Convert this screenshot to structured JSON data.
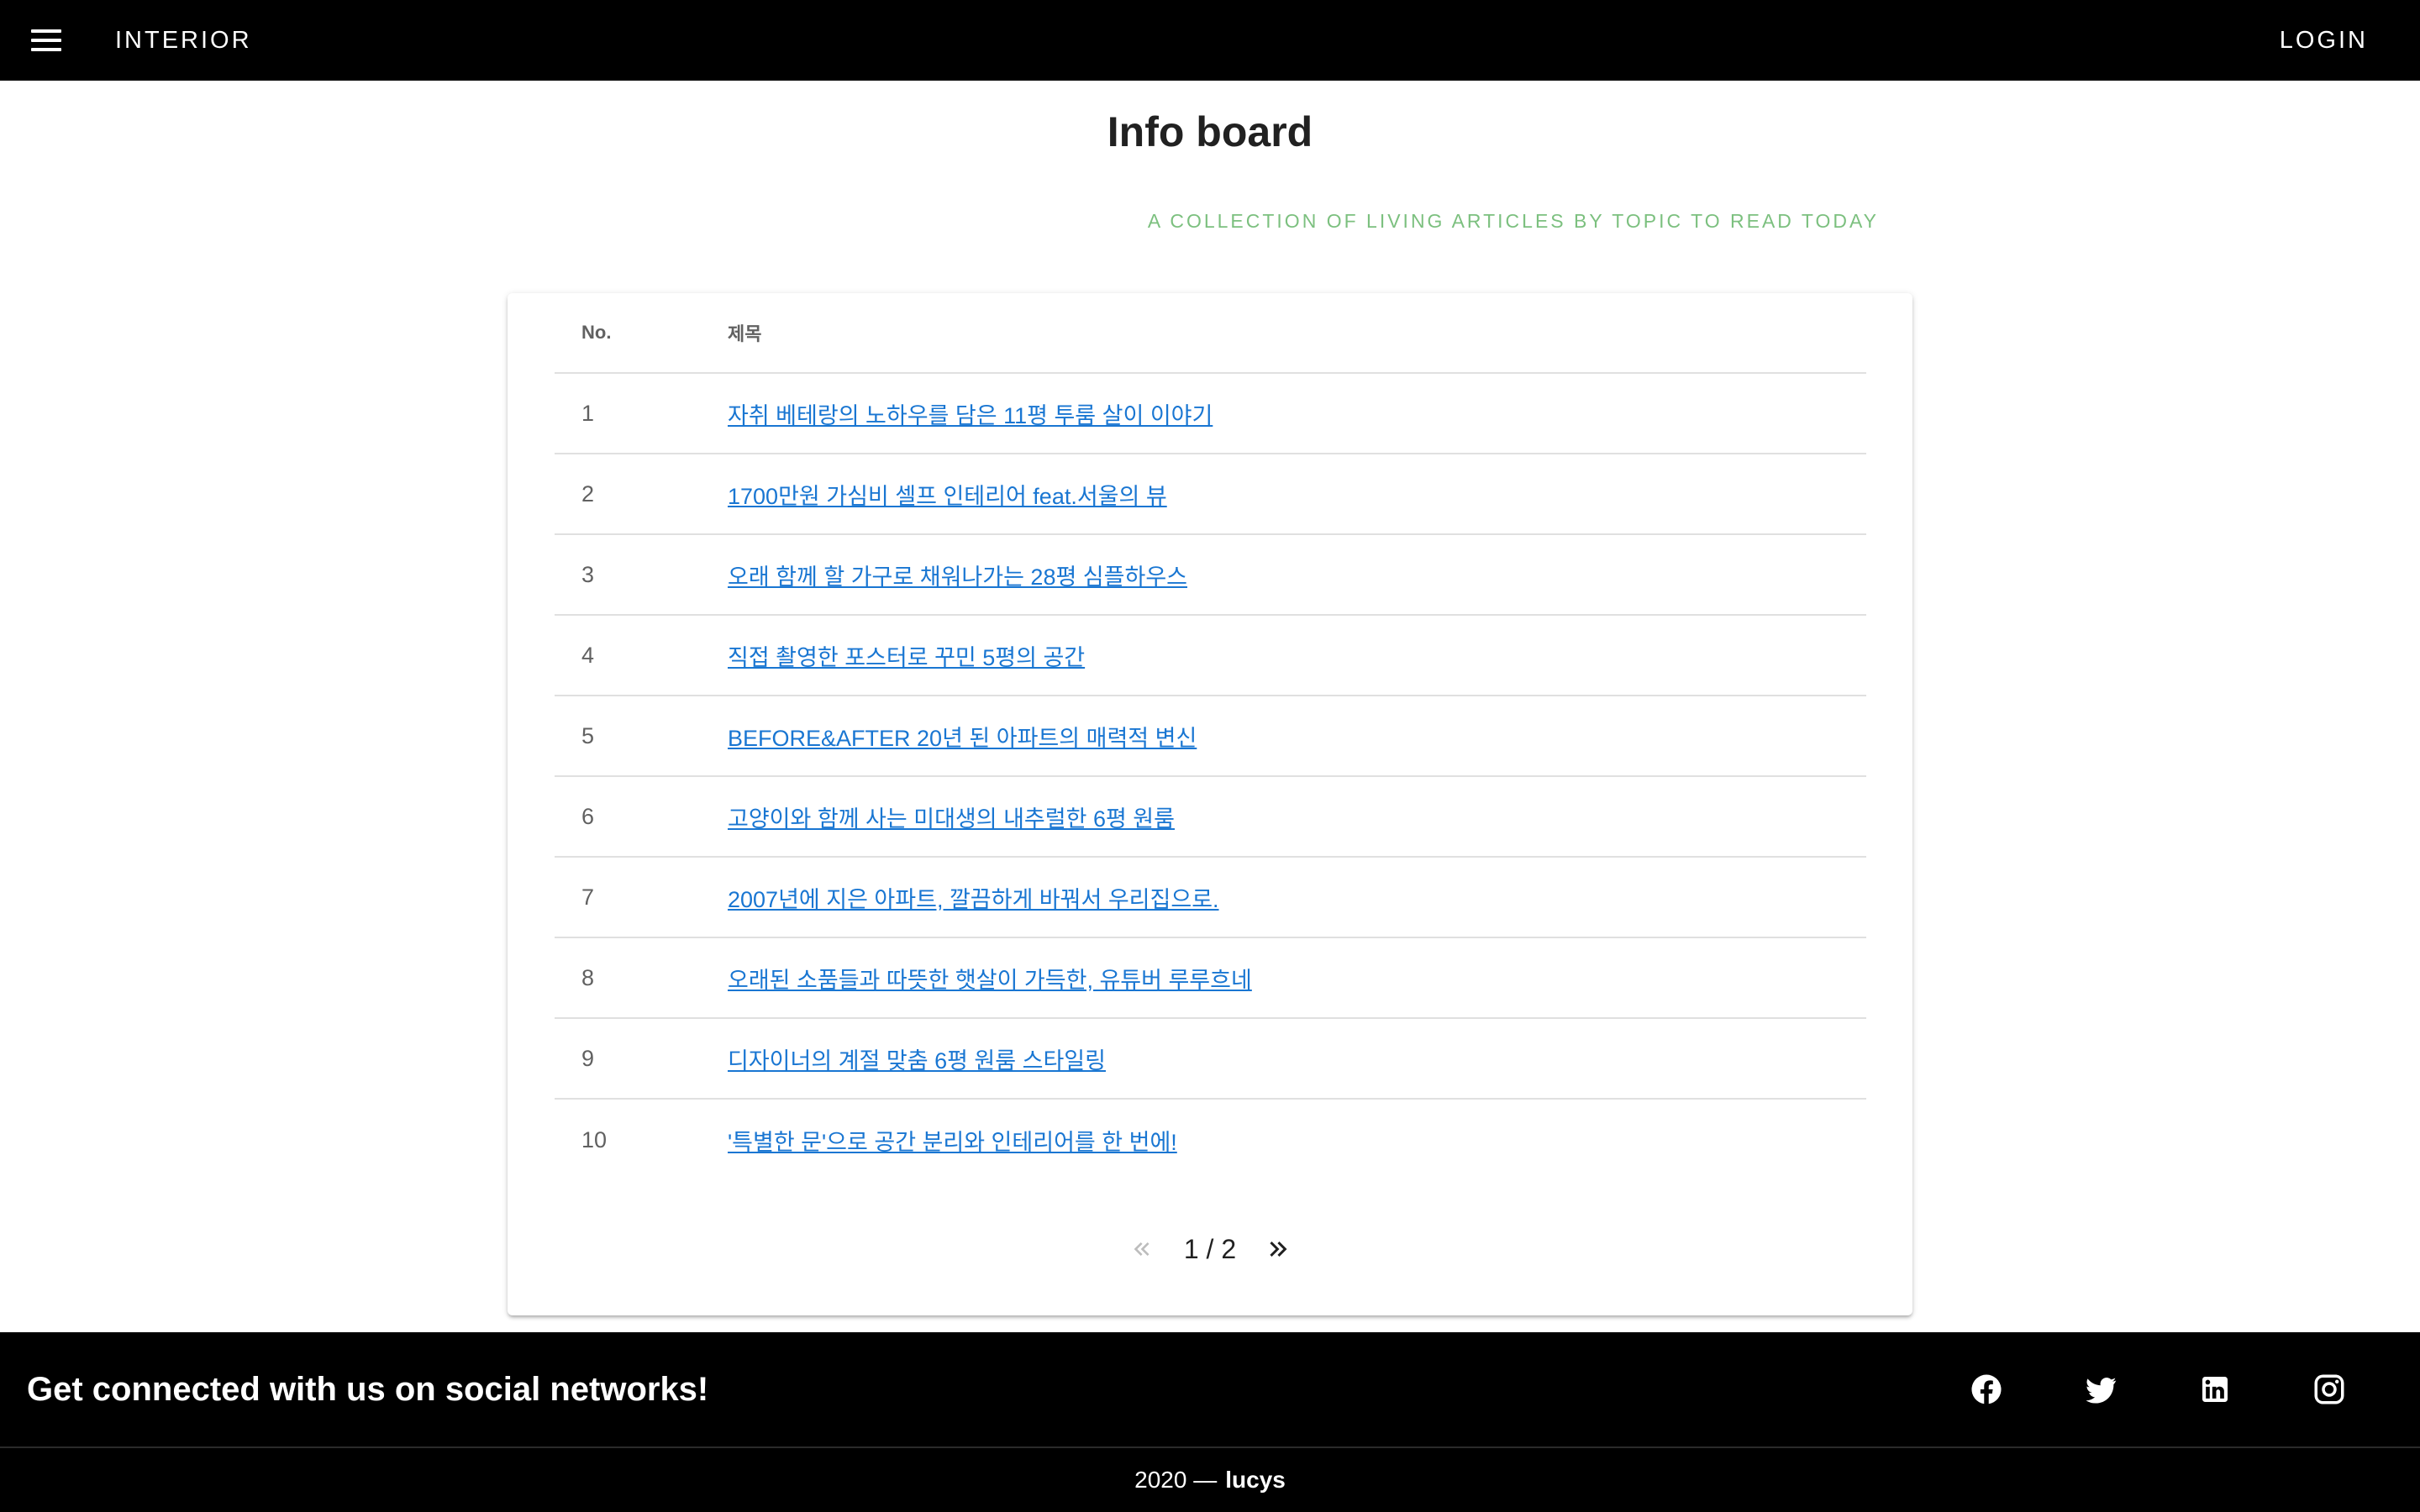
{
  "header": {
    "brand": "INTERIOR",
    "login": "LOGIN",
    "menu_icon": "menu-icon"
  },
  "page": {
    "title": "Info board",
    "subtitle": "A COLLECTION OF LIVING ARTICLES BY TOPIC TO READ TODAY"
  },
  "table": {
    "columns": [
      "No.",
      "제목"
    ],
    "rows": [
      {
        "no": "1",
        "title": "자취 베테랑의 노하우를 담은 11평 투룸 살이 이야기"
      },
      {
        "no": "2",
        "title": "1700만원 가심비 셀프 인테리어 feat.서울의 뷰"
      },
      {
        "no": "3",
        "title": "오래 함께 할 가구로 채워나가는 28평 심플하우스"
      },
      {
        "no": "4",
        "title": "직접 촬영한 포스터로 꾸민 5평의 공간"
      },
      {
        "no": "5",
        "title": "BEFORE&AFTER 20년 된 아파트의 매력적 변신"
      },
      {
        "no": "6",
        "title": "고양이와 함께 사는 미대생의 내추럴한 6평 원룸"
      },
      {
        "no": "7",
        "title": "2007년에 지은 아파트, 깔끔하게 바꿔서 우리집으로."
      },
      {
        "no": "8",
        "title": "오래된 소품들과 따뜻한 햇살이 가득한, 유튜버 루루흐네"
      },
      {
        "no": "9",
        "title": "디자이너의 계절 맞춤 6평 원룸 스타일링"
      },
      {
        "no": "10",
        "title": "'특별한 문'으로 공간 분리와 인테리어를 한 번에!"
      }
    ]
  },
  "pagination": {
    "text": "1 / 2",
    "prev_icon": "double-chevron-left-icon",
    "next_icon": "double-chevron-right-icon"
  },
  "footer": {
    "message": "Get connected with us on social networks!",
    "socials": [
      "facebook-icon",
      "twitter-icon",
      "linkedin-icon",
      "instagram-icon"
    ],
    "copyright_year": "2020 —",
    "copyright_name": "lucys"
  },
  "colors": {
    "bar": "#000000",
    "accent_link": "#1976d2",
    "subtitle_green": "#7cc07f"
  }
}
